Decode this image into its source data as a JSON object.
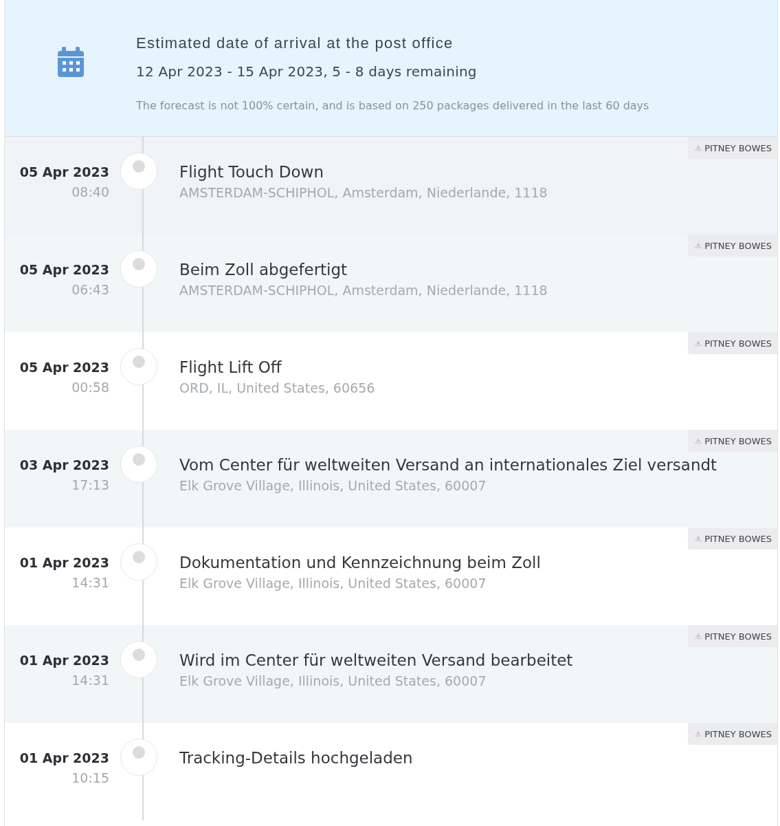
{
  "estimate": {
    "title": "Estimated date of arrival at the post office",
    "range": "12 Apr 2023 - 15 Apr 2023, 5 - 8 days remaining",
    "note": "The forecast is not 100% certain, and is based on 250 packages delivered in the last 60 days"
  },
  "events": [
    {
      "date": "05 Apr 2023",
      "time": "08:40",
      "title": "Flight Touch Down",
      "location": "AMSTERDAM-SCHIPHOL, Amsterdam, Niederlande, 1118",
      "carrier": "PITNEY BOWES",
      "color": "#f0f3f8"
    },
    {
      "date": "05 Apr 2023",
      "time": "06:43",
      "title": "Beim Zoll abgefertigt",
      "location": "AMSTERDAM-SCHIPHOL, Amsterdam, Niederlande, 1118",
      "carrier": "PITNEY BOWES",
      "color": "#f1f7f6"
    },
    {
      "date": "05 Apr 2023",
      "time": "00:58",
      "title": "Flight Lift Off",
      "location": "ORD, IL, United States, 60656",
      "carrier": "PITNEY BOWES",
      "color": "#ffffff"
    },
    {
      "date": "03 Apr 2023",
      "time": "17:13",
      "title": "Vom Center für weltweiten Versand an internationales Ziel versandt",
      "location": "Elk Grove Village, Illinois, United States, 60007",
      "carrier": "PITNEY BOWES",
      "color": "#f1f7f6"
    },
    {
      "date": "01 Apr 2023",
      "time": "14:31",
      "title": "Dokumentation und Kennzeichnung beim Zoll",
      "location": "Elk Grove Village, Illinois, United States, 60007",
      "carrier": "PITNEY BOWES",
      "color": "#ffffff"
    },
    {
      "date": "01 Apr 2023",
      "time": "14:31",
      "title": "Wird im Center für weltweiten Versand bearbeitet",
      "location": "Elk Grove Village, Illinois, United States, 60007",
      "carrier": "PITNEY BOWES",
      "color": "#f1f7f6"
    },
    {
      "date": "01 Apr 2023",
      "time": "10:15",
      "title": "Tracking-Details hochgeladen",
      "carrier": "PITNEY BOWES",
      "color": "#ffffff"
    }
  ]
}
